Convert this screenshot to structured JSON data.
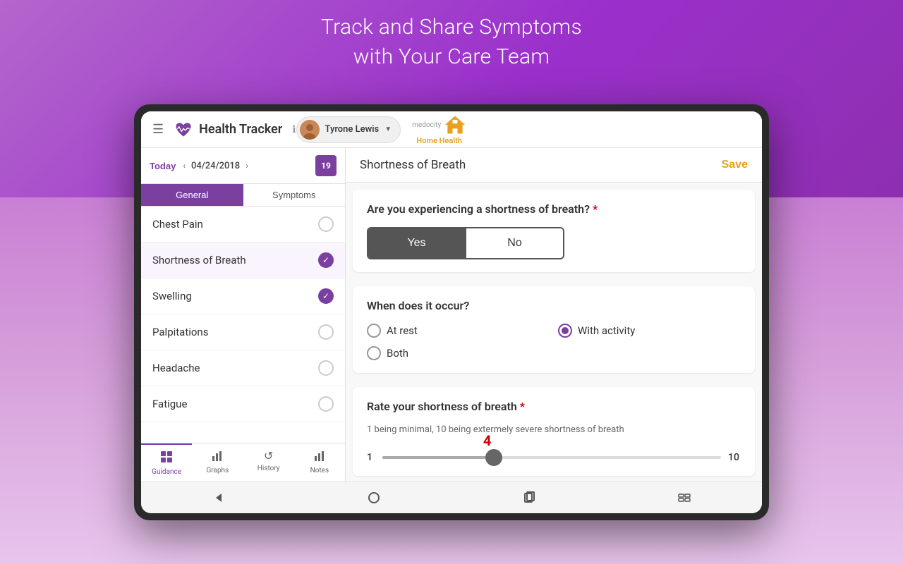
{
  "page": {
    "bg_tagline_line1": "Track and Share Symptoms",
    "bg_tagline_line2": "with Your Care Team"
  },
  "header": {
    "title": "Health Tracker",
    "info_icon": "ℹ",
    "user_name": "Tyrone Lewis",
    "brand_name": "medocity",
    "brand_product": "Home Health"
  },
  "date_bar": {
    "today_label": "Today",
    "date": "04/24/2018",
    "calendar_day": "19"
  },
  "tabs": {
    "general_label": "General",
    "symptoms_label": "Symptoms"
  },
  "symptom_list": [
    {
      "id": "chest-pain",
      "label": "Chest Pain",
      "checked": false
    },
    {
      "id": "shortness-of-breath",
      "label": "Shortness of Breath",
      "checked": true
    },
    {
      "id": "swelling",
      "label": "Swelling",
      "checked": true
    },
    {
      "id": "palpitations",
      "label": "Palpitations",
      "checked": false
    },
    {
      "id": "headache",
      "label": "Headache",
      "checked": false
    },
    {
      "id": "fatigue",
      "label": "Fatigue",
      "checked": false
    }
  ],
  "bottom_nav": [
    {
      "id": "guidance",
      "label": "Guidance",
      "icon": "⊞",
      "active": true
    },
    {
      "id": "graphs",
      "label": "Graphs",
      "icon": "▐▌",
      "active": false
    },
    {
      "id": "history",
      "label": "History",
      "icon": "↺",
      "active": false
    },
    {
      "id": "notes",
      "label": "Notes",
      "icon": "▐▌",
      "active": false
    }
  ],
  "panel": {
    "title": "Shortness of Breath",
    "save_label": "Save",
    "question1": {
      "text": "Are you experiencing a shortness of breath?",
      "required": true,
      "yes_label": "Yes",
      "no_label": "No",
      "selected": "yes"
    },
    "question2": {
      "text": "When does it occur?",
      "options": [
        {
          "id": "at-rest",
          "label": "At rest",
          "selected": false
        },
        {
          "id": "with-activity",
          "label": "With activity",
          "selected": true
        },
        {
          "id": "both",
          "label": "Both",
          "selected": false
        }
      ]
    },
    "question3": {
      "text": "Rate your shortness of breath",
      "required": true,
      "description": "1 being minimal, 10 being extermely severe shortness of breath",
      "min": "1",
      "max": "10",
      "current_value": "4",
      "slider_percent": 33
    }
  }
}
